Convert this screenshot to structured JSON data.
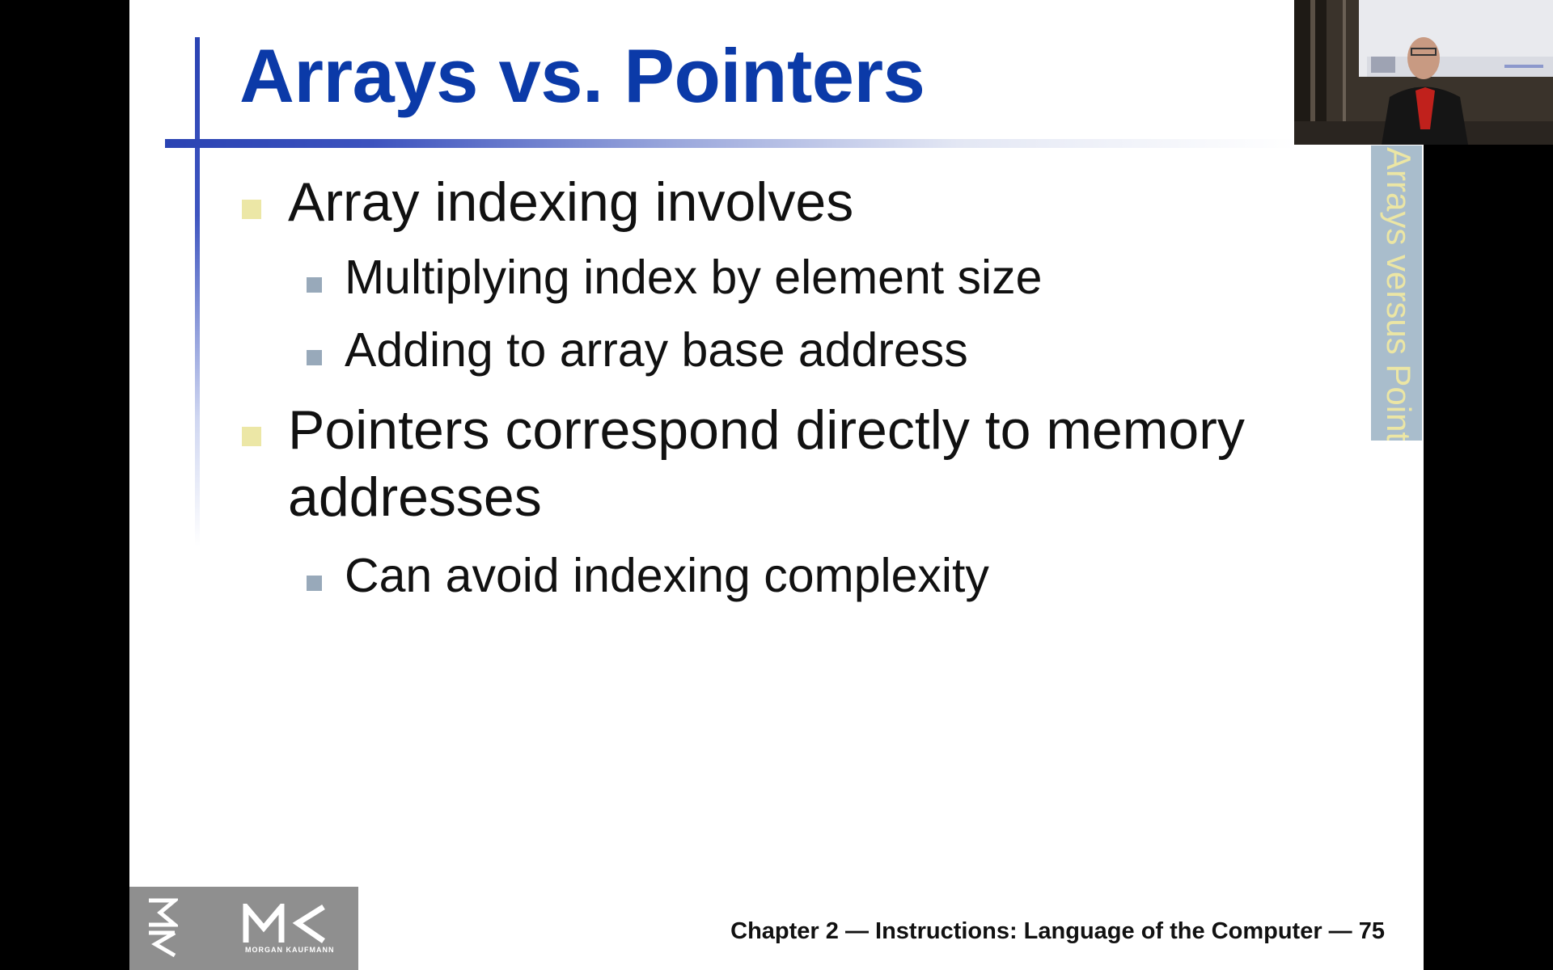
{
  "slide": {
    "title": "Arrays vs. Pointers",
    "side_tab": "Arrays versus Pointers",
    "bullets": [
      {
        "text": "Array indexing involves",
        "sub": [
          "Multiplying index by element size",
          "Adding to array base address"
        ]
      },
      {
        "text_line1": "Pointers correspond directly to memory",
        "text_line2": "addresses",
        "sub": [
          "Can avoid indexing complexity"
        ]
      }
    ],
    "footer": "Chapter 2 — Instructions: Language of the Computer — 75",
    "logo": {
      "letters": "MK",
      "subtitle": "MORGAN KAUFMANN"
    }
  },
  "webcam": {
    "content": "presenter-video"
  },
  "colors": {
    "title": "#0b3aa8",
    "accent_rule": "#2a43b3",
    "bullet_level1": "#ece7a6",
    "bullet_level2": "#98a9ba",
    "side_tab_bg": "#a9bdcc",
    "side_tab_text": "#ece6a4",
    "logo_bg": "#8f8f8f"
  }
}
